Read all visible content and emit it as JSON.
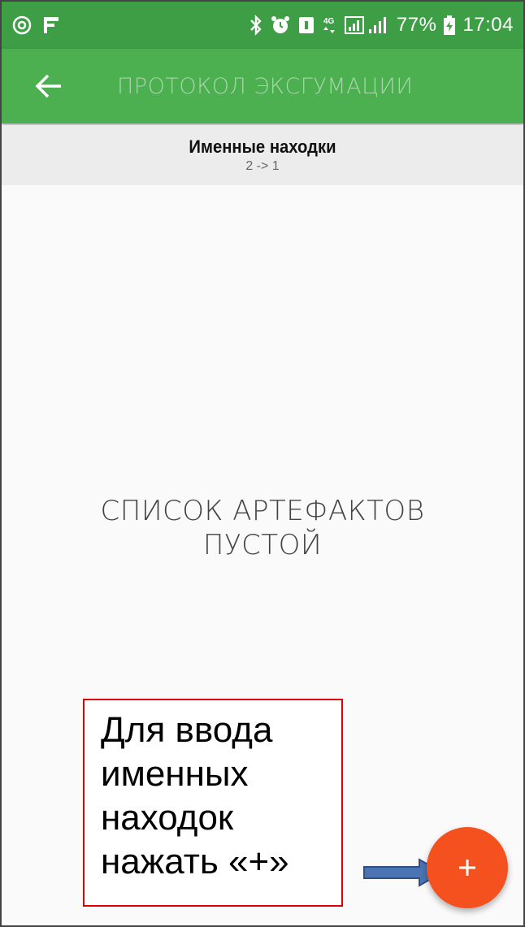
{
  "status_bar": {
    "battery_percent": "77%",
    "time": "17:04",
    "network_label": "4G",
    "icons": [
      "at-sign-icon",
      "flag-icon",
      "bluetooth-icon",
      "alarm-icon",
      "sim-icon",
      "network-4g-icon",
      "signal-icon",
      "battery-icon"
    ]
  },
  "toolbar": {
    "title": "ПРОТОКОЛ ЭКСГУМАЦИИ",
    "back_icon": "arrow-left-icon",
    "background_color": "#4caf50",
    "title_color": "#a5d6a7"
  },
  "section": {
    "title": "Именные находки",
    "subtitle": "2 -> 1"
  },
  "empty_state": {
    "line1": "СПИСОК АРТЕФАКТОВ",
    "line2": "ПУСТОЙ"
  },
  "annotation": {
    "text": "Для ввода\nименных\nнаходок\nнажать «+»",
    "border_color": "#e00000"
  },
  "fab": {
    "label": "+",
    "color": "#f4511e"
  }
}
